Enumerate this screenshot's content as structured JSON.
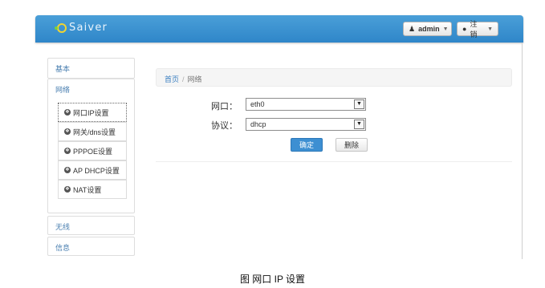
{
  "header": {
    "brand": "Saiver",
    "user_label": "admin",
    "user_icon": "user-icon",
    "logout_label": "注销",
    "logout_icon": "drop-icon",
    "accent_color": "#3a8fd0"
  },
  "sidebar": {
    "sections": [
      {
        "label": "基本"
      },
      {
        "label": "网络"
      },
      {
        "label": "无线"
      },
      {
        "label": "信息"
      }
    ],
    "network_items": [
      {
        "label": "网口IP设置",
        "icon": "globe-icon",
        "active": true
      },
      {
        "label": "网关/dns设置",
        "icon": "globe-icon"
      },
      {
        "label": "PPPOE设置",
        "icon": "globe-icon"
      },
      {
        "label": "AP DHCP设置",
        "icon": "globe-icon"
      },
      {
        "label": "NAT设置",
        "icon": "globe-icon"
      }
    ]
  },
  "breadcrumb": {
    "home": "首页",
    "separator": "/",
    "current": "网络"
  },
  "form": {
    "port_label": "网口：",
    "port_value": "eth0",
    "protocol_label": "协议：",
    "protocol_value": "dhcp",
    "ok_label": "确定",
    "delete_label": "删除"
  },
  "caption": "图 网口 IP 设置"
}
